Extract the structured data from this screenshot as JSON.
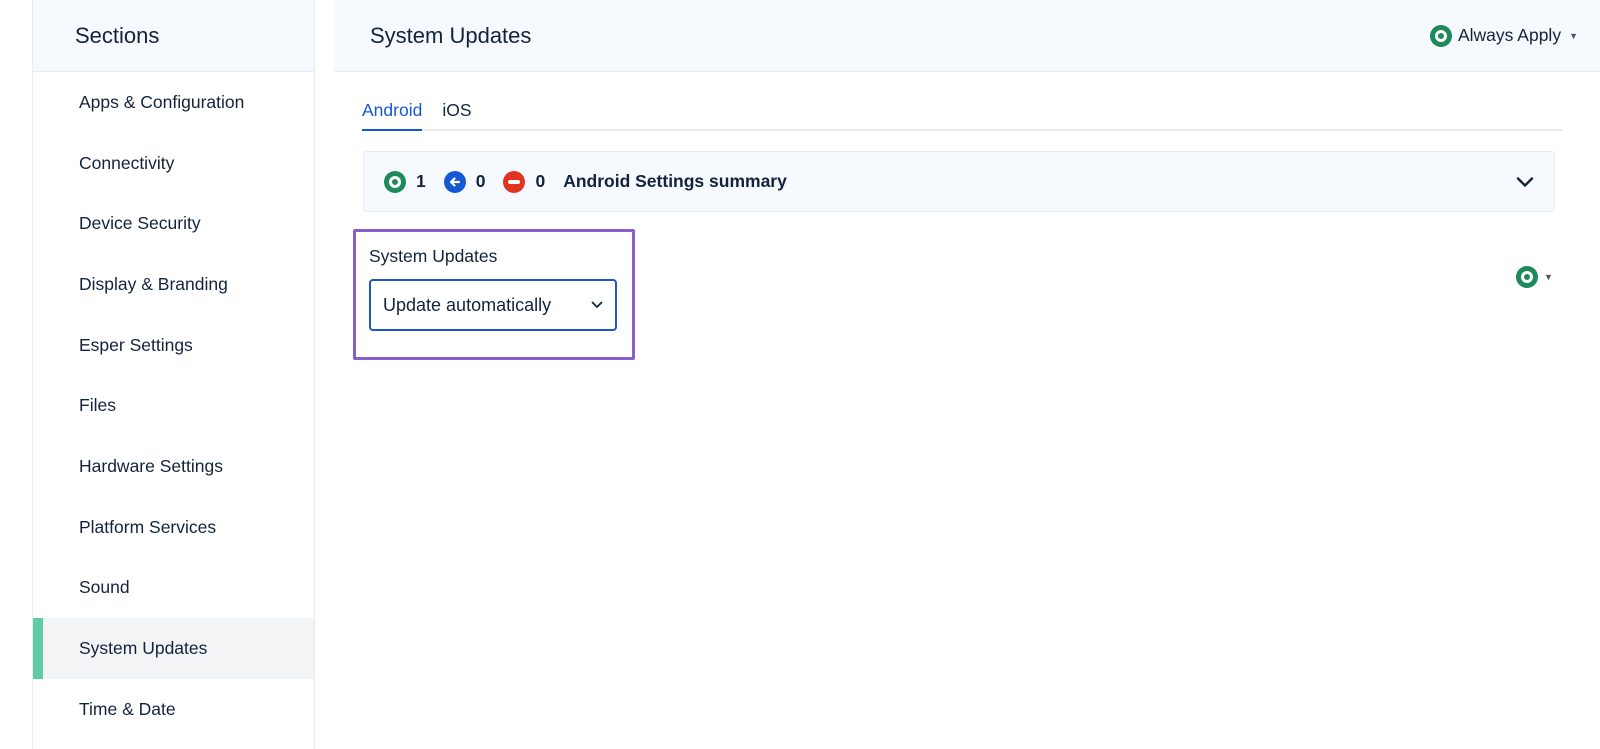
{
  "sidebar": {
    "title": "Sections",
    "items": [
      {
        "label": "Apps & Configuration"
      },
      {
        "label": "Connectivity"
      },
      {
        "label": "Device Security"
      },
      {
        "label": "Display & Branding"
      },
      {
        "label": "Esper Settings"
      },
      {
        "label": "Files"
      },
      {
        "label": "Hardware Settings"
      },
      {
        "label": "Platform Services"
      },
      {
        "label": "Sound"
      },
      {
        "label": "System Updates",
        "active": true
      },
      {
        "label": "Time & Date"
      }
    ]
  },
  "header": {
    "title": "System Updates",
    "apply_mode": "Always Apply",
    "apply_icon": "green-ring-icon"
  },
  "tabs": [
    {
      "label": "Android",
      "active": true
    },
    {
      "label": "iOS",
      "active": false
    }
  ],
  "summary": {
    "applied_count": "1",
    "inherited_count": "0",
    "blocked_count": "0",
    "label": "Android Settings summary"
  },
  "setting": {
    "label": "System Updates",
    "selected": "Update automatically",
    "status_icon": "green-ring-icon"
  },
  "colors": {
    "accent": "#1558d6",
    "active_bar": "#5fcca4",
    "applied": "#1c8a5a",
    "blocked": "#e1341e",
    "highlight_border": "#8c5dcc"
  }
}
